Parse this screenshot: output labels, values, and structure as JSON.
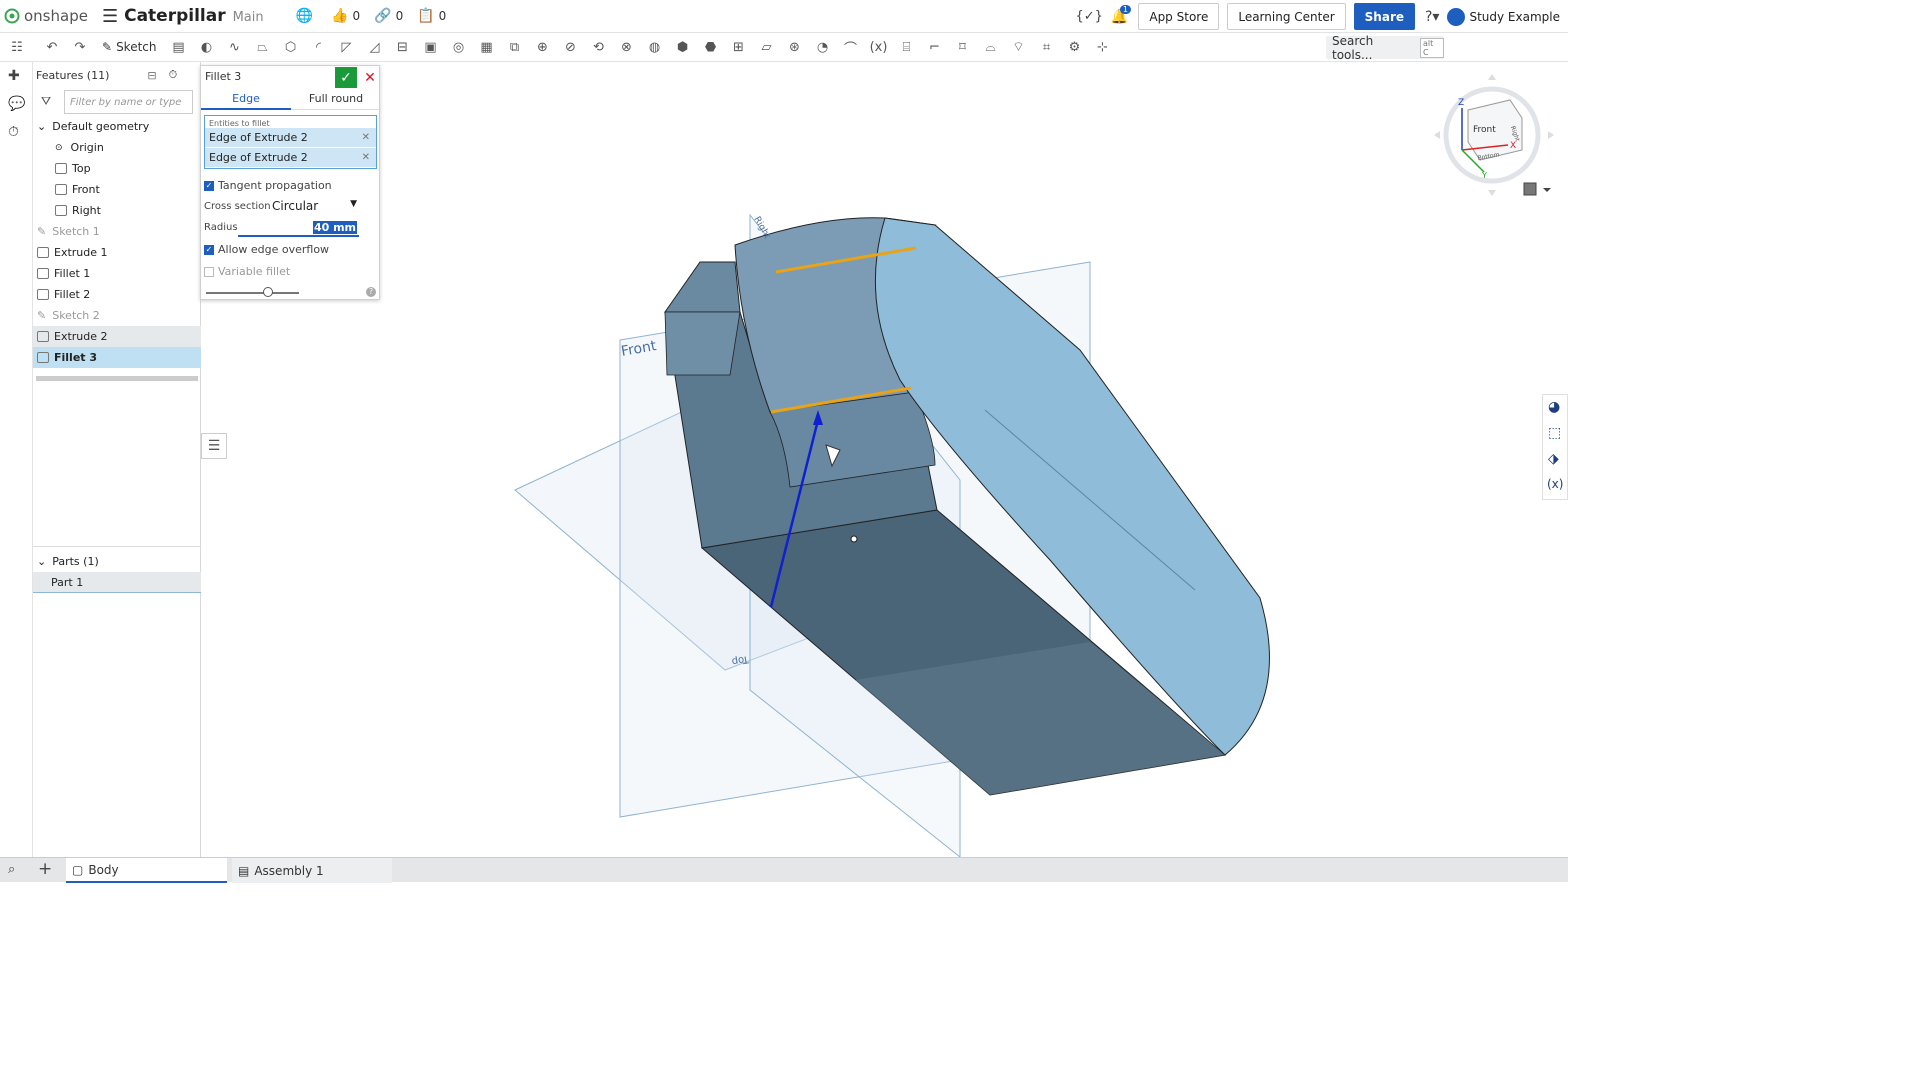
{
  "app": {
    "logo_text": "onshape",
    "doc_title": "Caterpillar",
    "branch": "Main"
  },
  "counters": {
    "likes": "0",
    "links": "0",
    "copies": "0"
  },
  "header": {
    "notifications": "1",
    "app_store": "App Store",
    "learning_center": "Learning Center",
    "share": "Share",
    "user": "Study Example"
  },
  "toolbar": {
    "sketch": "Sketch",
    "search_placeholder": "Search tools...",
    "search_shortcut": "alt C"
  },
  "features": {
    "title": "Features (11)",
    "filter_placeholder": "Filter by name or type",
    "default_geometry": "Default geometry",
    "geometry": [
      "Origin",
      "Top",
      "Front",
      "Right"
    ],
    "items": [
      "Sketch 1",
      "Extrude 1",
      "Fillet 1",
      "Fillet 2",
      "Sketch 2",
      "Extrude 2",
      "Fillet 3"
    ]
  },
  "parts": {
    "title": "Parts (1)",
    "items": [
      "Part 1"
    ]
  },
  "fillet_dialog": {
    "title": "Fillet 3",
    "tabs": [
      "Edge",
      "Full round"
    ],
    "entities_label": "Entities to fillet",
    "entities": [
      "Edge of Extrude 2",
      "Edge of Extrude 2"
    ],
    "tangent_propagation": "Tangent propagation",
    "cross_section_label": "Cross section",
    "cross_section_value": "Circular",
    "radius_label": "Radius",
    "radius_value": "40 mm",
    "allow_edge_overflow": "Allow edge overflow",
    "variable_fillet": "Variable fillet"
  },
  "viewport": {
    "front_plane": "Front",
    "top_plane": "Top",
    "right_plane": "Right"
  },
  "viewcube": {
    "front": "Front",
    "right": "Right",
    "bottom": "Bottom",
    "x": "X",
    "y": "Y",
    "z": "Z"
  },
  "bottom_tabs": [
    "Body",
    "Assembly 1"
  ],
  "colors": {
    "accent": "#1d5ebf",
    "part_light": "#8fbcd8",
    "part_dark": "#4a6478",
    "edge_highlight": "#e8a317",
    "confirm": "#1b9a3c"
  }
}
